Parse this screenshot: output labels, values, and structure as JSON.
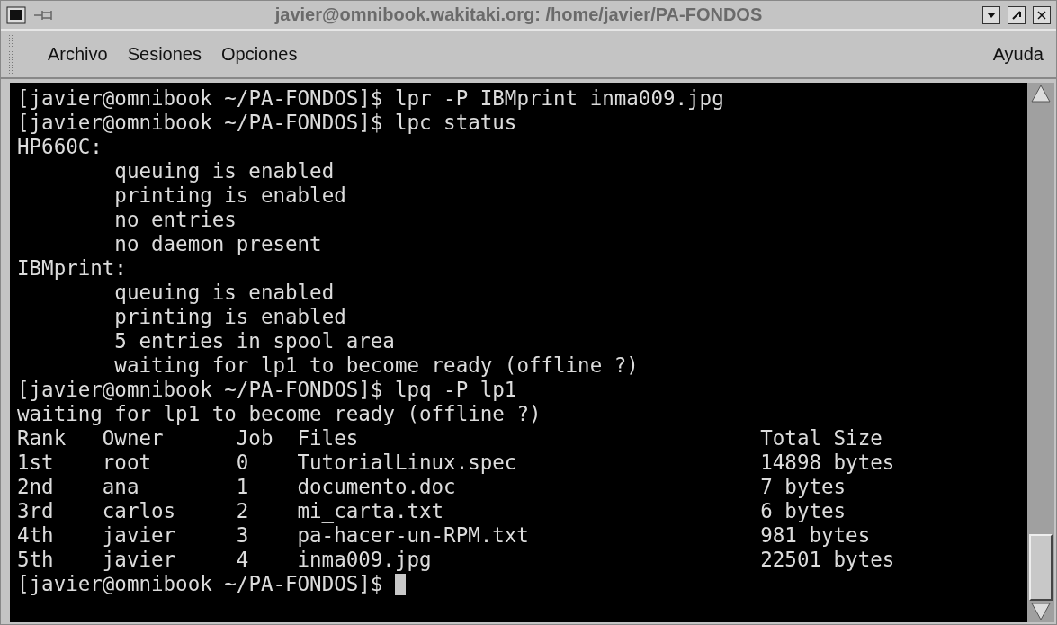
{
  "window": {
    "title": "javier@omnibook.wakitaki.org: /home/javier/PA-FONDOS"
  },
  "menu": {
    "items": [
      "Archivo",
      "Sesiones",
      "Opciones"
    ],
    "help": "Ayuda"
  },
  "terminal": {
    "lines_before": [
      {
        "kind": "plain",
        "text": "[javier@omnibook ~/PA-FONDOS]$ lpr -P IBMprint inma009.jpg"
      },
      {
        "kind": "plain",
        "text": "[javier@omnibook ~/PA-FONDOS]$ lpc status"
      },
      {
        "kind": "plain",
        "text": "HP660C:"
      },
      {
        "kind": "indented",
        "text": "queuing is enabled"
      },
      {
        "kind": "indented",
        "text": "printing is enabled"
      },
      {
        "kind": "indented",
        "text": "no entries"
      },
      {
        "kind": "indented",
        "text": "no daemon present"
      },
      {
        "kind": "plain",
        "text": "IBMprint:"
      },
      {
        "kind": "indented",
        "text": "queuing is enabled"
      },
      {
        "kind": "indented",
        "text": "printing is enabled"
      },
      {
        "kind": "indented",
        "text": "5 entries in spool area"
      },
      {
        "kind": "indented",
        "text": "waiting for lp1 to become ready (offline ?)"
      },
      {
        "kind": "plain",
        "text": "[javier@omnibook ~/PA-FONDOS]$ lpq -P lp1"
      },
      {
        "kind": "plain",
        "text": "waiting for lp1 to become ready (offline ?)"
      }
    ],
    "queue": {
      "columns": [
        "Rank",
        "Owner",
        "Job",
        "Files",
        "Total Size"
      ],
      "rows": [
        [
          "1st",
          "root",
          "0",
          "TutorialLinux.spec",
          "14898 bytes"
        ],
        [
          "2nd",
          "ana",
          "1",
          "documento.doc",
          "7 bytes"
        ],
        [
          "3rd",
          "carlos",
          "2",
          "mi_carta.txt",
          "6 bytes"
        ],
        [
          "4th",
          "javier",
          "3",
          "pa-hacer-un-RPM.txt",
          "981 bytes"
        ],
        [
          "5th",
          "javier",
          "4",
          "inma009.jpg",
          "22501 bytes"
        ]
      ]
    },
    "prompt": "[javier@omnibook ~/PA-FONDOS]$"
  }
}
